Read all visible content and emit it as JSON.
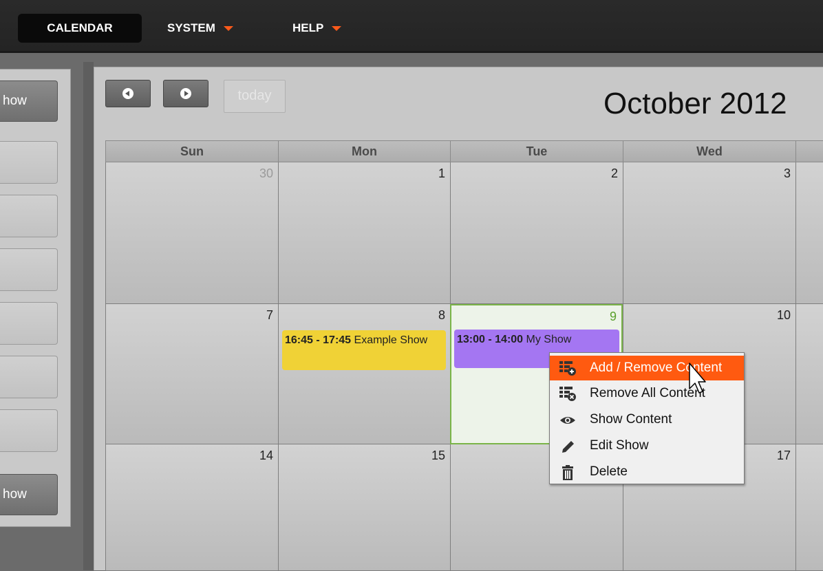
{
  "nav": {
    "calendar": "CALENDAR",
    "system": "SYSTEM",
    "help": "HELP"
  },
  "left_panel": {
    "top_button": "how",
    "bottom_button": "how"
  },
  "toolbar": {
    "today": "today"
  },
  "header": {
    "month_title": "October 2012"
  },
  "days_of_week": [
    "Sun",
    "Mon",
    "Tue",
    "Wed"
  ],
  "weeks": [
    [
      "30",
      "1",
      "2",
      "3"
    ],
    [
      "7",
      "8",
      "9",
      "10"
    ],
    [
      "14",
      "15",
      "",
      "17"
    ]
  ],
  "events": {
    "mon8": {
      "time": "16:45 - 17:45",
      "title": "Example Show",
      "color": "#f0d236"
    },
    "tue9": {
      "time": "13:00 - 14:00",
      "title": "My Show",
      "color": "#a476f2"
    }
  },
  "context_menu": {
    "items": [
      {
        "label": "Add / Remove Content",
        "icon": "add-content-icon"
      },
      {
        "label": "Remove All Content",
        "icon": "remove-content-icon"
      },
      {
        "label": "Show Content",
        "icon": "eye-icon"
      },
      {
        "label": "Edit Show",
        "icon": "pencil-icon"
      },
      {
        "label": "Delete",
        "icon": "trash-icon"
      }
    ]
  },
  "colors": {
    "accent": "#ff5a10",
    "today_border": "#7ab448"
  }
}
